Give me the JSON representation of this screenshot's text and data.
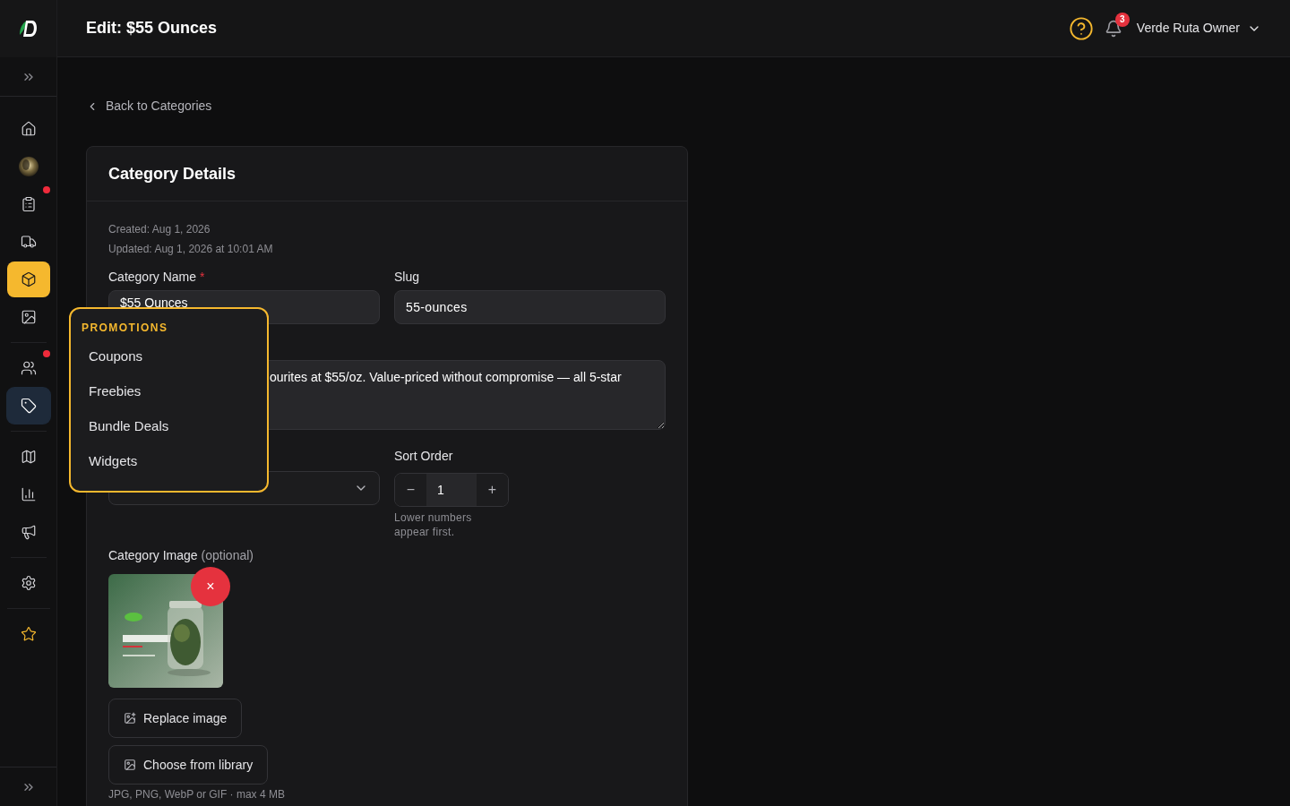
{
  "header": {
    "title": "Edit: $55 Ounces",
    "notifications": "3",
    "user": "Verde Ruta Owner"
  },
  "sidebar": {
    "groups": [
      [
        {
          "kind": "home",
          "selected": false,
          "open": false,
          "alert": false
        },
        {
          "kind": "avatar",
          "selected": false,
          "open": false,
          "alert": false
        },
        {
          "kind": "orders",
          "selected": false,
          "open": false,
          "alert": true
        },
        {
          "kind": "delivery",
          "selected": false,
          "open": false,
          "alert": false
        },
        {
          "kind": "products",
          "selected": true,
          "open": false,
          "alert": false
        },
        {
          "kind": "media",
          "selected": false,
          "open": false,
          "alert": false
        }
      ],
      [
        {
          "kind": "customers",
          "selected": false,
          "open": false,
          "alert": true
        },
        {
          "kind": "promotions",
          "selected": false,
          "open": true,
          "alert": false
        }
      ],
      [
        {
          "kind": "map",
          "selected": false,
          "open": false,
          "alert": false
        },
        {
          "kind": "reports",
          "selected": false,
          "open": false,
          "alert": false
        },
        {
          "kind": "marketing",
          "selected": false,
          "open": false,
          "alert": false
        }
      ],
      [
        {
          "kind": "settings",
          "selected": false,
          "open": false,
          "alert": false
        }
      ],
      [
        {
          "kind": "favorites",
          "selected": false,
          "open": false,
          "alert": false
        }
      ]
    ]
  },
  "back_link": "Back to Categories",
  "card": {
    "title": "Category Details",
    "created": "Created: Aug 1, 2026",
    "updated": "Updated: Aug 1, 2026 at 10:01 AM",
    "name_label": "Category Name",
    "required_mark": "*",
    "name_value": "$55 Ounces",
    "slug_label": "Slug",
    "slug_value": "55-ounces",
    "description_value": "ourites at $55/oz. Value-priced without compromise — all 5-star",
    "sort_label": "Sort Order",
    "sort_value": "1",
    "sort_minus": "−",
    "sort_plus": "+",
    "sort_hint": "Lower numbers appear first.",
    "image_label": "Category Image",
    "image_optional": "(optional)",
    "remove": "×",
    "replace_button": "Replace image",
    "library_button": "Choose from library",
    "file_hint": "JPG, PNG, WebP or GIF · max 4 MB"
  },
  "menu": {
    "title": "PROMOTIONS",
    "items": [
      "Coupons",
      "Freebies",
      "Bundle Deals",
      "Widgets"
    ]
  }
}
